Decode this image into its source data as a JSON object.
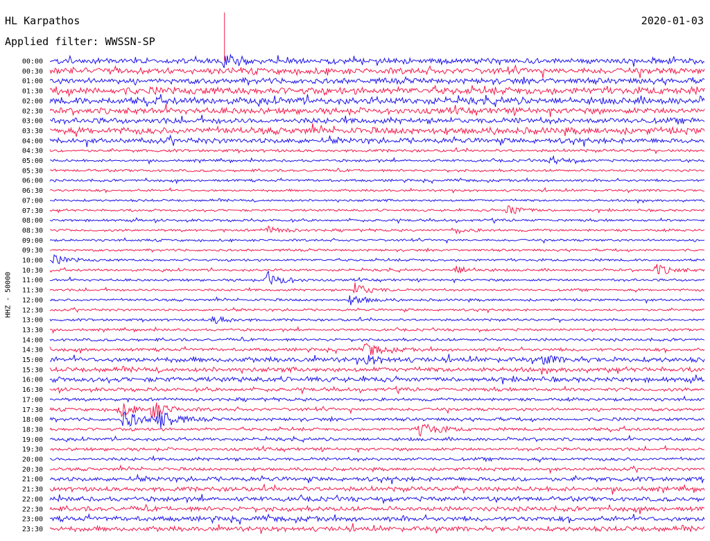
{
  "header": {
    "station": "HL Karpathos",
    "filter_text": "Applied filter: WWSSN-SP",
    "date": "2020-01-03"
  },
  "channel_label": "HHZ - 50000",
  "colors": {
    "trace_a": "#1a10e8",
    "trace_b": "#f0184a",
    "background": "#ffffff"
  },
  "chart_data": {
    "type": "line",
    "title": "",
    "ylabel": "HHZ - 50000",
    "row_labels": [
      "00:00",
      "00:30",
      "01:00",
      "01:30",
      "02:00",
      "02:30",
      "03:00",
      "03:30",
      "04:00",
      "04:30",
      "05:00",
      "05:30",
      "06:00",
      "06:30",
      "07:00",
      "07:30",
      "08:00",
      "08:30",
      "09:00",
      "09:30",
      "10:00",
      "10:30",
      "11:00",
      "11:30",
      "12:00",
      "12:30",
      "13:00",
      "13:30",
      "14:00",
      "14:30",
      "15:00",
      "15:30",
      "16:00",
      "16:30",
      "17:00",
      "17:30",
      "18:00",
      "18:30",
      "19:00",
      "19:30",
      "20:00",
      "20:30",
      "21:00",
      "21:30",
      "22:00",
      "22:30",
      "23:00",
      "23:30"
    ],
    "row_colors": [
      "#1a10e8",
      "#f0184a"
    ],
    "row_noise_amplitude": [
      3.0,
      3.5,
      3.2,
      4.2,
      4.0,
      3.5,
      3.2,
      3.8,
      3.0,
      1.6,
      1.4,
      1.4,
      1.4,
      1.3,
      1.3,
      1.3,
      1.4,
      1.4,
      1.3,
      1.3,
      1.4,
      1.4,
      1.4,
      1.3,
      1.4,
      1.3,
      1.4,
      1.4,
      1.6,
      1.8,
      2.8,
      2.6,
      2.8,
      2.0,
      1.8,
      1.8,
      1.8,
      1.8,
      1.8,
      1.8,
      1.8,
      1.8,
      2.5,
      2.6,
      2.6,
      2.7,
      2.8,
      2.8
    ],
    "events": [
      {
        "row": 0,
        "minute": 8.0,
        "amplitude": 12
      },
      {
        "row": 10,
        "minute": 23.0,
        "amplitude": 6
      },
      {
        "row": 15,
        "minute": 21.0,
        "amplitude": 8
      },
      {
        "row": 17,
        "minute": 10.0,
        "amplitude": 5
      },
      {
        "row": 17,
        "minute": 18.5,
        "amplitude": 4
      },
      {
        "row": 20,
        "minute": 0.2,
        "amplitude": 6
      },
      {
        "row": 21,
        "minute": 18.6,
        "amplitude": 6
      },
      {
        "row": 21,
        "minute": 27.8,
        "amplitude": 8
      },
      {
        "row": 22,
        "minute": 10.0,
        "amplitude": 12
      },
      {
        "row": 23,
        "minute": 14.0,
        "amplitude": 10
      },
      {
        "row": 24,
        "minute": 13.8,
        "amplitude": 8
      },
      {
        "row": 26,
        "minute": 7.5,
        "amplitude": 6
      },
      {
        "row": 29,
        "minute": 14.5,
        "amplitude": 10
      },
      {
        "row": 30,
        "minute": 14.5,
        "amplitude": 6
      },
      {
        "row": 30,
        "minute": 22.6,
        "amplitude": 6
      },
      {
        "row": 35,
        "minute": 3.2,
        "amplitude": 10
      },
      {
        "row": 35,
        "minute": 4.7,
        "amplitude": 14
      },
      {
        "row": 36,
        "minute": 3.4,
        "amplitude": 14
      },
      {
        "row": 36,
        "minute": 5.0,
        "amplitude": 18
      },
      {
        "row": 37,
        "minute": 17.0,
        "amplitude": 14
      }
    ],
    "x_range_minutes": [
      0,
      30
    ],
    "grid": false
  }
}
